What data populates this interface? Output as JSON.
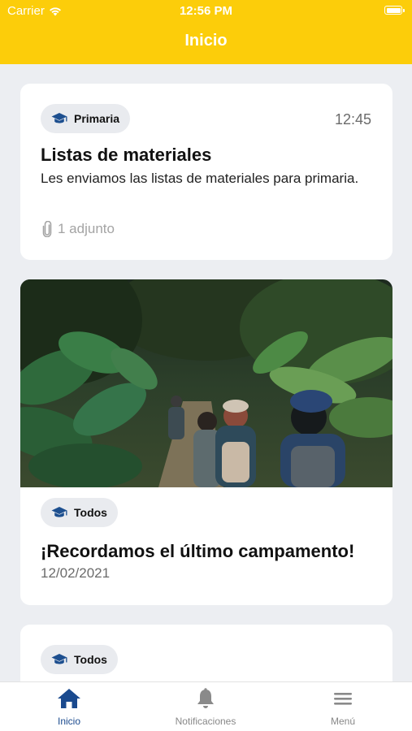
{
  "status_bar": {
    "carrier": "Carrier",
    "time": "12:56 PM"
  },
  "header": {
    "title": "Inicio",
    "color": "#fccd0a"
  },
  "feed": [
    {
      "tag": "Primaria",
      "tag_icon": "graduation-cap-icon",
      "time": "12:45",
      "title": "Listas de materiales",
      "body": "Les enviamos las listas de materiales para primaria.",
      "attachments": "1 adjunto",
      "attachment_icon": "paperclip-icon"
    },
    {
      "image": "forest-hikers-photo",
      "tag": "Todos",
      "tag_icon": "graduation-cap-icon",
      "title": "¡Recordamos el último campamento!",
      "date": "12/02/2021"
    },
    {
      "tag": "Todos",
      "tag_icon": "graduation-cap-icon"
    }
  ],
  "tabbar": {
    "items": [
      {
        "label": "Inicio",
        "icon": "home-icon",
        "active": true
      },
      {
        "label": "Notificaciones",
        "icon": "bell-icon",
        "active": false
      },
      {
        "label": "Menú",
        "icon": "menu-icon",
        "active": false
      }
    ],
    "active_color": "#1a4a8e",
    "inactive_color": "#888888"
  }
}
